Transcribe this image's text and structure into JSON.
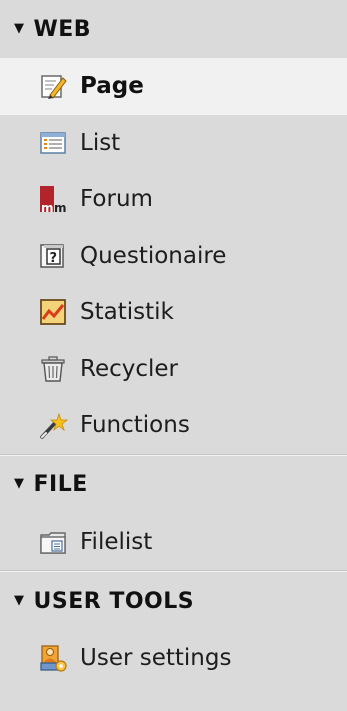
{
  "sections": [
    {
      "title": "WEB",
      "items": [
        {
          "label": "Page",
          "icon": "page-edit-icon",
          "active": true
        },
        {
          "label": "List",
          "icon": "list-icon"
        },
        {
          "label": "Forum",
          "icon": "forum-mm-icon"
        },
        {
          "label": "Questionaire",
          "icon": "questionaire-icon"
        },
        {
          "label": "Statistik",
          "icon": "statistik-chart-icon"
        },
        {
          "label": "Recycler",
          "icon": "trash-icon"
        },
        {
          "label": "Functions",
          "icon": "magic-wand-icon"
        }
      ]
    },
    {
      "title": "FILE",
      "items": [
        {
          "label": "Filelist",
          "icon": "filelist-folder-icon"
        }
      ]
    },
    {
      "title": "USER TOOLS",
      "items": [
        {
          "label": "User settings",
          "icon": "user-settings-icon"
        }
      ]
    }
  ],
  "colors": {
    "background": "#dadada",
    "active_background": "#f1f1f1"
  }
}
